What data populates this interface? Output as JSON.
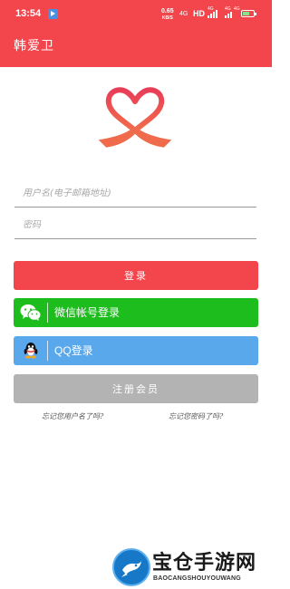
{
  "status_bar": {
    "time": "13:54",
    "speed_value": "0.65",
    "speed_unit": "KB/S",
    "network": "4G",
    "hd": "HD",
    "signal1_label": "4G",
    "signal2_label": "4G",
    "signal3_label": "4G"
  },
  "app_bar": {
    "title": "韩爱卫"
  },
  "form": {
    "username_placeholder": "用户名(电子邮箱地址)",
    "password_placeholder": "密码"
  },
  "buttons": {
    "login": "登录",
    "wechat_login": "微信帐号登录",
    "qq_login": "QQ登录",
    "register": "注册会员"
  },
  "links": {
    "forgot_username": "忘记您用户名了吗?",
    "forgot_password": "忘记您密码了吗?"
  },
  "watermark": {
    "title": "宝仓手游网",
    "subtitle": "BAOCANGSHOUYOUWANG"
  },
  "colors": {
    "primary": "#f2454c",
    "wechat": "#1dbd1d",
    "qq": "#5aa8ec",
    "register": "#b3b3b3"
  },
  "icons": {
    "logo": "heart-ribbon-logo",
    "wechat": "wechat-icon",
    "qq": "qq-penguin-icon"
  }
}
